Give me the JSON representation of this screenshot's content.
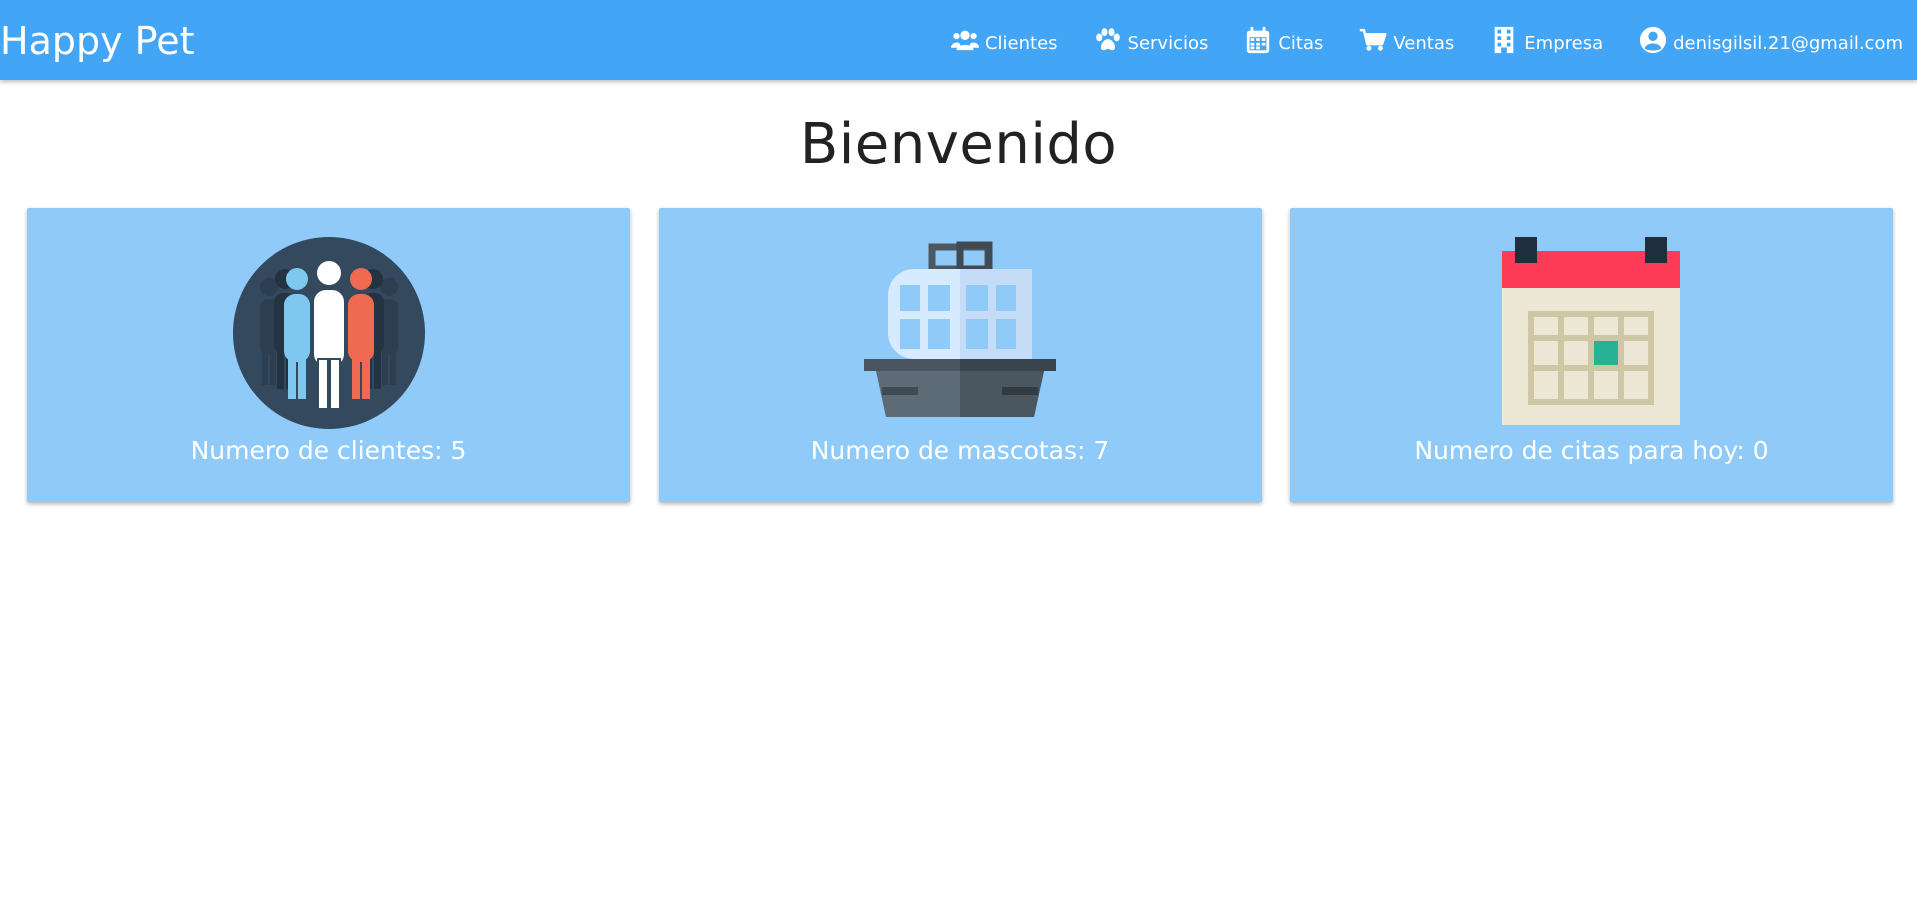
{
  "header": {
    "brand": "Happy Pet",
    "nav": [
      {
        "label": "Clientes",
        "icon": "users-icon"
      },
      {
        "label": "Servicios",
        "icon": "paw-icon"
      },
      {
        "label": "Citas",
        "icon": "calendar-icon"
      },
      {
        "label": "Ventas",
        "icon": "cart-icon"
      },
      {
        "label": "Empresa",
        "icon": "building-icon"
      },
      {
        "label": "denisgilsil.21@gmail.com",
        "icon": "user-circle-icon"
      }
    ]
  },
  "main": {
    "title": "Bienvenido",
    "cards": [
      {
        "caption": "Numero de clientes: 5",
        "icon": "people-group-icon"
      },
      {
        "caption": "Numero de mascotas: 7",
        "icon": "pet-carrier-icon"
      },
      {
        "caption": "Numero de citas para hoy: 0",
        "icon": "calendar-illustration-icon"
      }
    ]
  },
  "colors": {
    "navbar": "#42a5f5",
    "card": "#90caf9",
    "text_light": "#ffffff",
    "title": "#222222"
  }
}
